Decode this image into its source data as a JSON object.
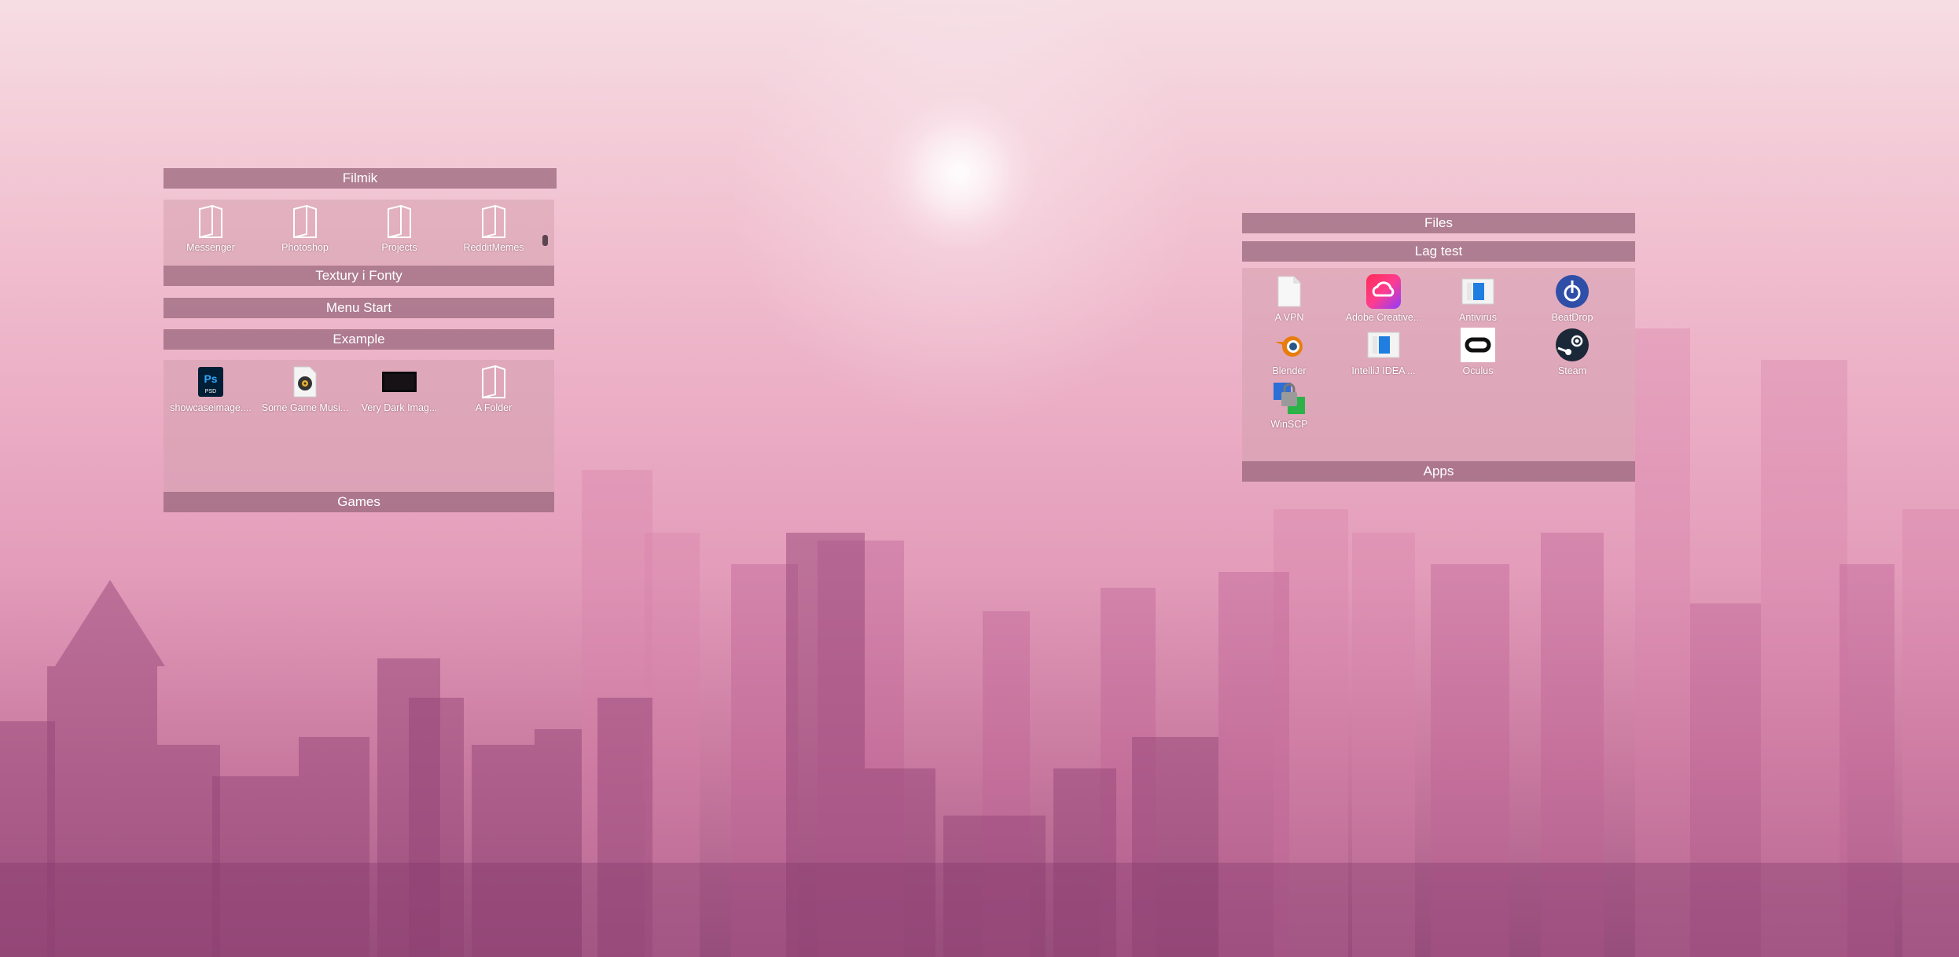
{
  "left_column": {
    "filmik": {
      "title": "Filmik",
      "items": [
        {
          "label": "Messenger",
          "icon": "folder-icon"
        },
        {
          "label": "Photoshop",
          "icon": "folder-icon"
        },
        {
          "label": "Projects",
          "icon": "folder-icon"
        },
        {
          "label": "RedditMemes",
          "icon": "folder-icon"
        }
      ]
    },
    "textury_title": "Textury i Fonty",
    "menu_start_title": "Menu Start",
    "example": {
      "title": "Example",
      "items": [
        {
          "label": "showcaseimage....",
          "icon": "psd-file-icon"
        },
        {
          "label": "Some Game Musi...",
          "icon": "audio-file-icon"
        },
        {
          "label": "Very Dark Imag...",
          "icon": "dark-image-thumbnail"
        },
        {
          "label": "A Folder",
          "icon": "folder-icon"
        }
      ]
    },
    "games_title": "Games"
  },
  "right_column": {
    "files_title": "Files",
    "lag_test": {
      "title": "Lag test",
      "items": [
        {
          "label": "A VPN",
          "icon": "blank-file-icon"
        },
        {
          "label": "Adobe Creative...",
          "icon": "adobe-creative-cloud-icon"
        },
        {
          "label": "Antivirus",
          "icon": "antivirus-icon"
        },
        {
          "label": "BeatDrop",
          "icon": "beatdrop-icon"
        },
        {
          "label": "Blender",
          "icon": "blender-icon"
        },
        {
          "label": "IntelliJ IDEA ...",
          "icon": "intellij-icon"
        },
        {
          "label": "Oculus",
          "icon": "oculus-icon"
        },
        {
          "label": "Steam",
          "icon": "steam-icon"
        },
        {
          "label": "WinSCP",
          "icon": "winscp-icon"
        }
      ]
    },
    "apps_title": "Apps"
  },
  "colors": {
    "bar_bg": "#96647a",
    "panel_bg": "#d2a0af",
    "text": "#ffffff"
  }
}
